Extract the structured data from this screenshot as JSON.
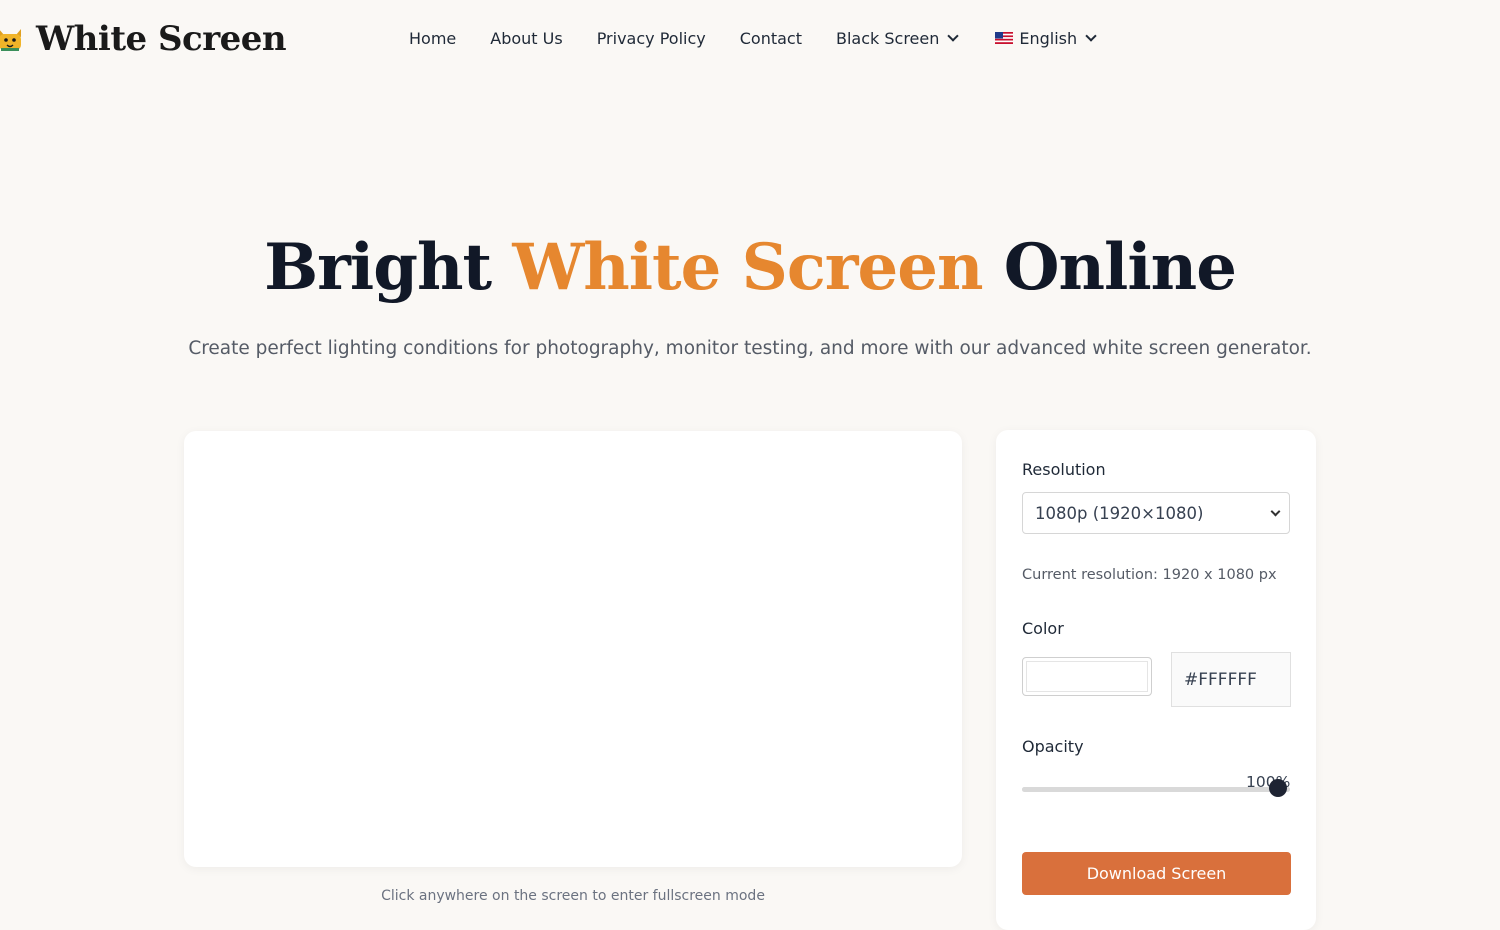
{
  "header": {
    "logo_text": "White Screen",
    "logo_icon": "cat-icon",
    "nav": {
      "home": "Home",
      "about": "About Us",
      "privacy": "Privacy Policy",
      "contact": "Contact",
      "black_screen": "Black Screen",
      "language": "English"
    }
  },
  "hero": {
    "title_part1": "Bright ",
    "title_accent": "White Screen",
    "title_part2": " Online",
    "subtitle": "Create perfect lighting conditions for photography, monitor testing, and more with our advanced white screen generator."
  },
  "preview": {
    "hint": "Click anywhere on the screen to enter fullscreen mode"
  },
  "controls": {
    "resolution_label": "Resolution",
    "resolution_selected": "1080p (1920×1080)",
    "resolution_note": "Current resolution: 1920 x 1080 px",
    "color_label": "Color",
    "color_hex": "#FFFFFF",
    "opacity_label": "Opacity",
    "opacity_value": "100%",
    "opacity_level": 100,
    "download_label": "Download Screen"
  },
  "colors": {
    "accent": "#e6872f",
    "button": "#d9703c",
    "background": "#faf8f5",
    "preview_color": "#FFFFFF"
  }
}
